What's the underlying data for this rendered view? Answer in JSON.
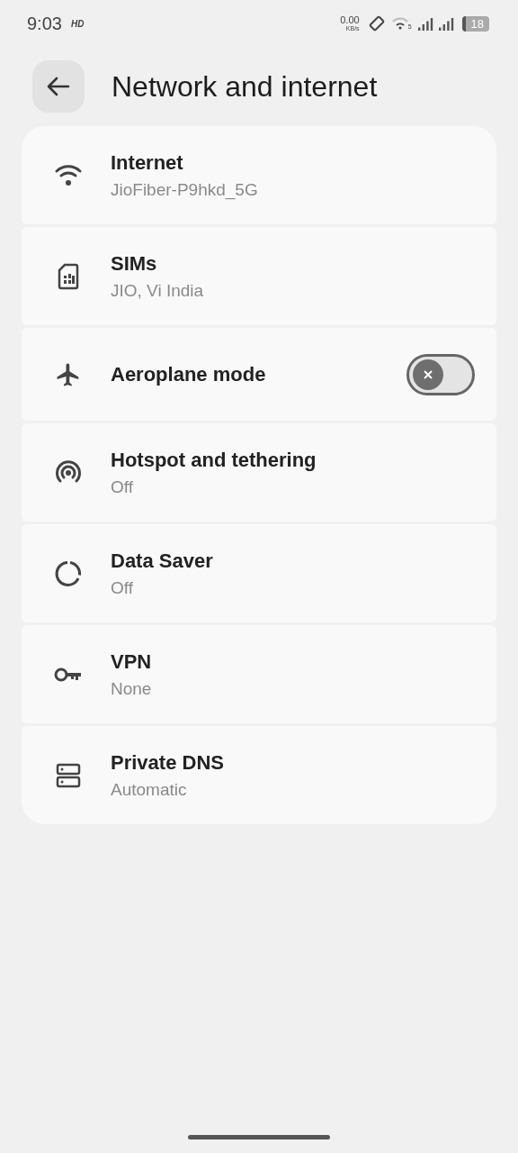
{
  "status_bar": {
    "time": "9:03",
    "hd": "HD",
    "speed": "0.00",
    "speed_unit": "KB/s",
    "wifi_label": "5",
    "battery": "18"
  },
  "header": {
    "title": "Network and internet"
  },
  "items": [
    {
      "kind": "nav",
      "title": "Internet",
      "subtitle": "JioFiber-P9hkd_5G"
    },
    {
      "kind": "nav",
      "title": "SIMs",
      "subtitle": "JIO, Vi India"
    },
    {
      "kind": "toggle",
      "title": "Aeroplane mode",
      "on": false
    },
    {
      "kind": "nav",
      "title": "Hotspot and tethering",
      "subtitle": "Off"
    },
    {
      "kind": "nav",
      "title": "Data Saver",
      "subtitle": "Off"
    },
    {
      "kind": "nav",
      "title": "VPN",
      "subtitle": "None"
    },
    {
      "kind": "nav",
      "title": "Private DNS",
      "subtitle": "Automatic"
    }
  ]
}
